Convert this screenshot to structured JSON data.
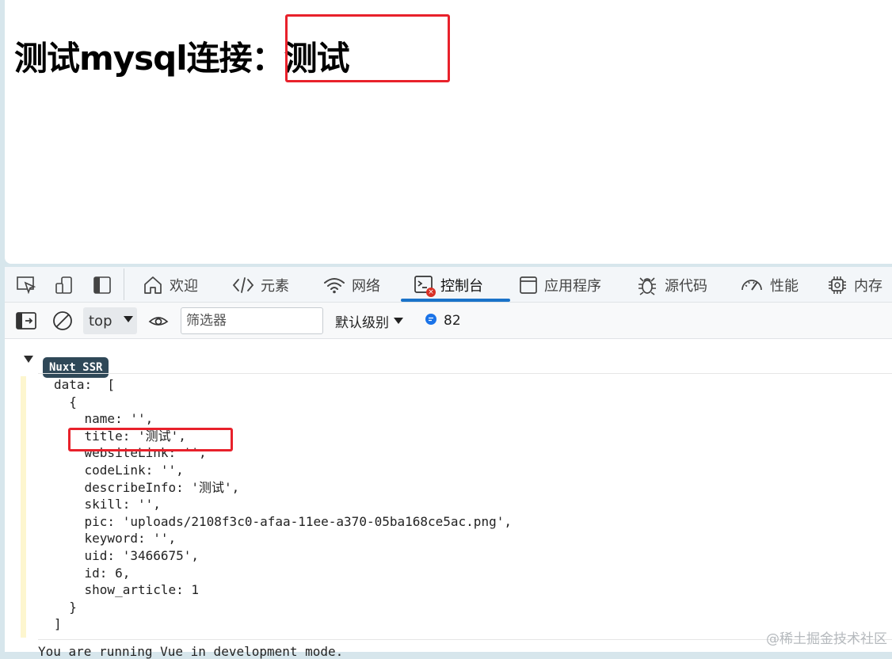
{
  "page": {
    "heading": "测试mysql连接：测试"
  },
  "devtools": {
    "tabs": [
      {
        "label": "欢迎",
        "icon": "home-icon"
      },
      {
        "label": "元素",
        "icon": "code-brackets-icon"
      },
      {
        "label": "网络",
        "icon": "wifi-icon"
      },
      {
        "label": "控制台",
        "icon": "console-icon"
      },
      {
        "label": "应用程序",
        "icon": "app-window-icon"
      },
      {
        "label": "源代码",
        "icon": "bug-icon"
      },
      {
        "label": "性能",
        "icon": "gauge-icon"
      },
      {
        "label": "内存",
        "icon": "chip-icon"
      }
    ],
    "active_tab": "控制台",
    "console_error_badge": "error-badge",
    "toolbar": {
      "context": "top",
      "filter_placeholder": "筛选器",
      "level": "默认级别",
      "message_count": "82"
    }
  },
  "console": {
    "group_label": "Nuxt SSR",
    "lines": [
      "data:  [",
      "  {",
      "    name: '',",
      "    title: '测试',",
      "    websiteLink: '',",
      "    codeLink: '',",
      "    describeInfo: '测试',",
      "    skill: '',",
      "    pic: 'uploads/2108f3c0-afaa-11ee-a370-05ba168ce5ac.png',",
      "    keyword: '',",
      "    uid: '3466675',",
      "    id: 6,",
      "    show_article: 1",
      "  }",
      "]"
    ],
    "vue_message": "You are running Vue in development mode."
  },
  "watermark": "@稀土掘金技术社区",
  "colors": {
    "highlight": "#e8212b",
    "accent": "#1a73c9",
    "badge_bg": "#2f4858"
  }
}
